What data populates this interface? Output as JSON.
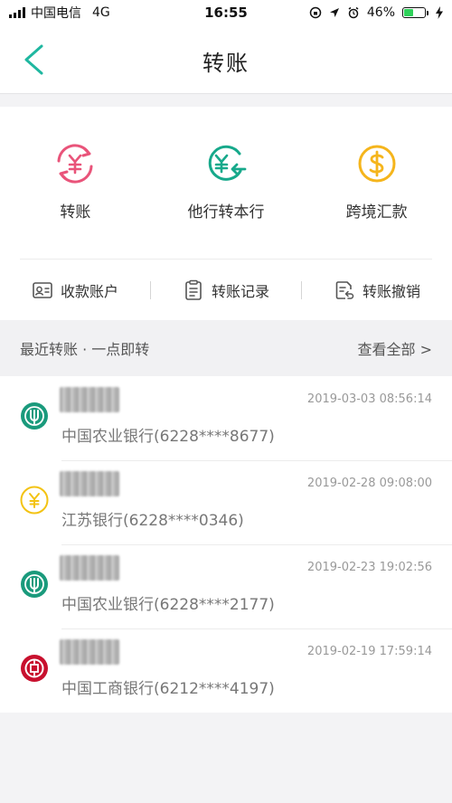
{
  "status_bar": {
    "carrier": "中国电信",
    "network": "4G",
    "time": "16:55",
    "battery": "46%",
    "battery_level": 0.46
  },
  "nav": {
    "title": "转账",
    "back_icon": "chevron-left-icon"
  },
  "services": [
    {
      "label": "转账",
      "icon": "yuan-transfer-icon",
      "color": "#e9547a"
    },
    {
      "label": "他行转本行",
      "icon": "yuan-inbound-icon",
      "color": "#17a98b"
    },
    {
      "label": "跨境汇款",
      "icon": "dollar-icon",
      "color": "#f5b51c"
    }
  ],
  "quick_actions": [
    {
      "label": "收款账户",
      "icon": "contact-card-icon"
    },
    {
      "label": "转账记录",
      "icon": "clipboard-icon"
    },
    {
      "label": "转账撤销",
      "icon": "document-undo-icon"
    }
  ],
  "recent": {
    "title": "最近转账 · 一点即转",
    "view_all": "查看全部 >",
    "items": [
      {
        "time": "2019-03-03 08:56:14",
        "bank": "中国农业银行(6228****8677)",
        "logo": "abc-bank-logo",
        "logo_color": "#1a9a7c"
      },
      {
        "time": "2019-02-28 09:08:00",
        "bank": "江苏银行(6228****0346)",
        "logo": "jiangsu-bank-logo",
        "logo_color": "#f3c313"
      },
      {
        "time": "2019-02-23 19:02:56",
        "bank": "中国农业银行(6228****2177)",
        "logo": "abc-bank-logo",
        "logo_color": "#1a9a7c"
      },
      {
        "time": "2019-02-19 17:59:14",
        "bank": "中国工商银行(6212****4197)",
        "logo": "icbc-bank-logo",
        "logo_color": "#c8102e"
      }
    ]
  }
}
